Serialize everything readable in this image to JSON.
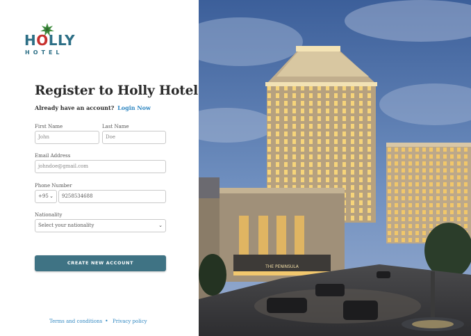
{
  "logo": {
    "word_part1": "H",
    "word_part2": "O",
    "word_part3": "LLY",
    "sub": "HOTEL"
  },
  "title": "Register to Holly Hotel",
  "subline": {
    "text": "Already have an account?",
    "link": "Login Now"
  },
  "form": {
    "first_name": {
      "label": "First Name",
      "placeholder": "John"
    },
    "last_name": {
      "label": "Last Name",
      "placeholder": "Doe"
    },
    "email": {
      "label": "Email Address",
      "placeholder": "johndoe@gmail.com"
    },
    "phone": {
      "label": "Phone Number",
      "code": "+95",
      "placeholder": "9258534688"
    },
    "nationality": {
      "label": "Nationality",
      "placeholder": "Select your nationality"
    },
    "submit": "CREATE NEW ACCOUNT"
  },
  "footer": {
    "terms": "Terms and conditions",
    "privacy": "Privacy policy"
  },
  "hero": {
    "sign": "THE PENINSULA"
  },
  "colors": {
    "accent": "#3f7384",
    "link": "#2e86c1",
    "brand_teal": "#2d6f86",
    "brand_red": "#c8312e"
  }
}
